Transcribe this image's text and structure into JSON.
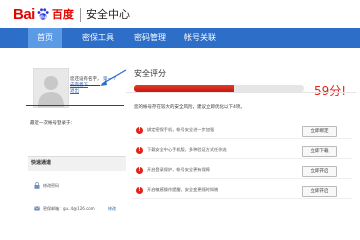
{
  "header": {
    "logo_bai": "Bai",
    "logo_du": "du",
    "logo_cn": "百度",
    "title": "安全中心"
  },
  "nav": [
    {
      "label": "首页"
    },
    {
      "label": "密保工具"
    },
    {
      "label": "密码管理"
    },
    {
      "label": "帐号关联"
    }
  ],
  "user": {
    "status": "您还设有名字，",
    "name_link": "第一个",
    "set_link": "去完善下",
    "logout_link": "退出"
  },
  "login_info": "最近一次帐号登录于：",
  "quick": {
    "title": "快速通道",
    "rows": [
      {
        "text": "修改密码",
        "icon": "lock-icon"
      },
      {
        "text": "密保邮箱：gu..4@126.com",
        "action": "修改",
        "icon": "email-icon"
      }
    ]
  },
  "score": {
    "title": "安全评分",
    "value_pct": 59,
    "value_text": "59分!",
    "hint": "您的帐号存在较大的安全风险，建议立即优化以下4项。"
  },
  "items": [
    {
      "text": "绑定密保手机，帐号安全进一步加强",
      "button": "立即绑定"
    },
    {
      "text": "下载安全中心手机版，多种验证方式任你选",
      "button": "立即下载"
    },
    {
      "text": "开启登录保护，帐号安全更有保障",
      "button": "立即开启"
    },
    {
      "text": "开启敏感操作提醒，安全变更随时知晓",
      "button": "立即开启"
    }
  ],
  "colors": {
    "nav_bg": "#2c6ec8",
    "nav_active": "#5b9be6",
    "brand_red": "#e10602",
    "brand_blue": "#2932e1",
    "score_red": "#e2231a"
  }
}
